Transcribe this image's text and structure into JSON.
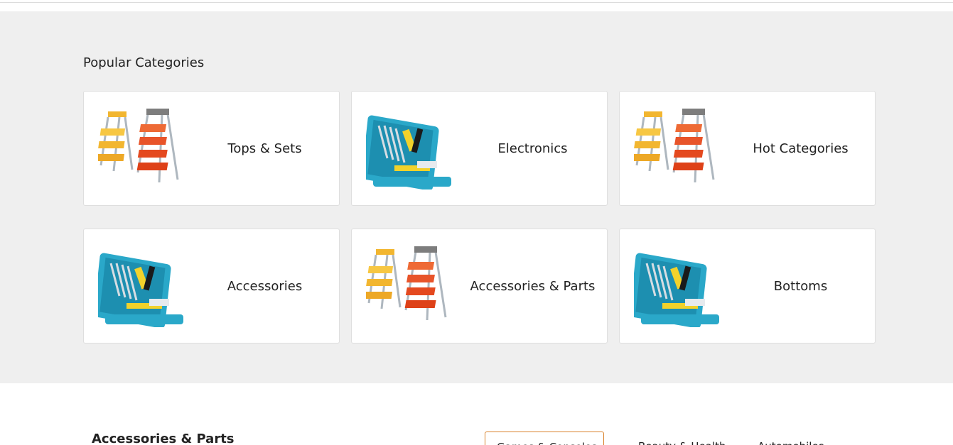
{
  "popular": {
    "title": "Popular Categories",
    "cards": [
      {
        "label": "Tops & Sets",
        "icon": "ladder-icon"
      },
      {
        "label": "Electronics",
        "icon": "toolbox-icon"
      },
      {
        "label": "Hot Categories",
        "icon": "ladder-icon"
      },
      {
        "label": "Accessories",
        "icon": "toolbox-icon"
      },
      {
        "label": "Accessories & Parts",
        "icon": "ladder-icon"
      },
      {
        "label": "Bottoms",
        "icon": "toolbox-icon"
      }
    ]
  },
  "lower": {
    "title": "Accessories & Parts",
    "tabs": [
      "Games & Consoles",
      "Beauty & Health",
      "Automobiles"
    ]
  },
  "colors": {
    "section_bg": "#efefef",
    "tab_active_border": "#d9822b",
    "toolbox": "#2aa8c9",
    "ladder_yellow": "#f2b630",
    "ladder_red": "#e8542a"
  }
}
